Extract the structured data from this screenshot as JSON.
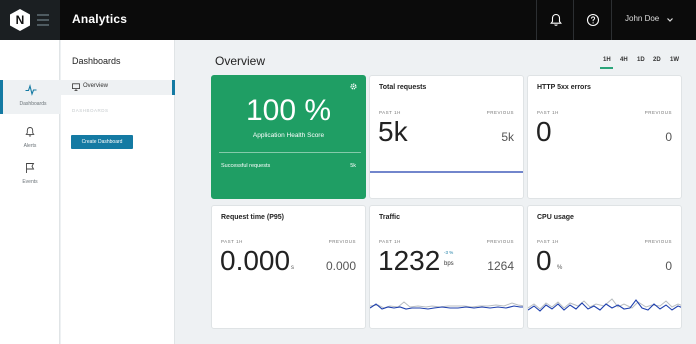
{
  "header": {
    "logo_letter": "N",
    "app_title": "Analytics",
    "user_name": "John Doe"
  },
  "rail": {
    "items": [
      {
        "label": "Dashboards",
        "icon": "pulse-icon",
        "active": true
      },
      {
        "label": "Alerts",
        "icon": "bell-icon",
        "active": false
      },
      {
        "label": "Events",
        "icon": "flag-icon",
        "active": false
      }
    ]
  },
  "sidebar": {
    "title": "Dashboards",
    "overview_label": "Overview",
    "section_label": "DASHBOARDS",
    "create_button": "Create Dashboard"
  },
  "main": {
    "title": "Overview",
    "time_ranges": [
      "1H",
      "4H",
      "1D",
      "2D",
      "1W"
    ],
    "selected_range": "1H"
  },
  "cards": {
    "health": {
      "value": "100 %",
      "label": "Application Health Score",
      "successful_label": "Successful requests",
      "successful_value": "5k"
    },
    "total_requests": {
      "title": "Total requests",
      "past_label": "PAST 1H",
      "prev_label": "PREVIOUS",
      "value": "5k",
      "previous": "5k"
    },
    "http5xx": {
      "title": "HTTP 5xx errors",
      "past_label": "PAST 1H",
      "prev_label": "PREVIOUS",
      "value": "0",
      "previous": "0"
    },
    "request_time": {
      "title": "Request time (P95)",
      "past_label": "PAST 1H",
      "prev_label": "PREVIOUS",
      "value": "0.000",
      "unit": "s",
      "previous": "0.000"
    },
    "traffic": {
      "title": "Traffic",
      "past_label": "PAST 1H",
      "prev_label": "PREVIOUS",
      "value": "1232",
      "unit": "bps",
      "delta": "-3 %",
      "previous": "1264"
    },
    "cpu": {
      "title": "CPU usage",
      "past_label": "PAST 1H",
      "prev_label": "PREVIOUS",
      "value": "0",
      "unit": "%",
      "previous": "0"
    }
  },
  "colors": {
    "accent": "#147aa3",
    "health_green": "#1f9e64",
    "topbar": "#0b0b0b",
    "sparkline_current": "#1d3fae",
    "sparkline_previous": "#b8bdc1"
  }
}
